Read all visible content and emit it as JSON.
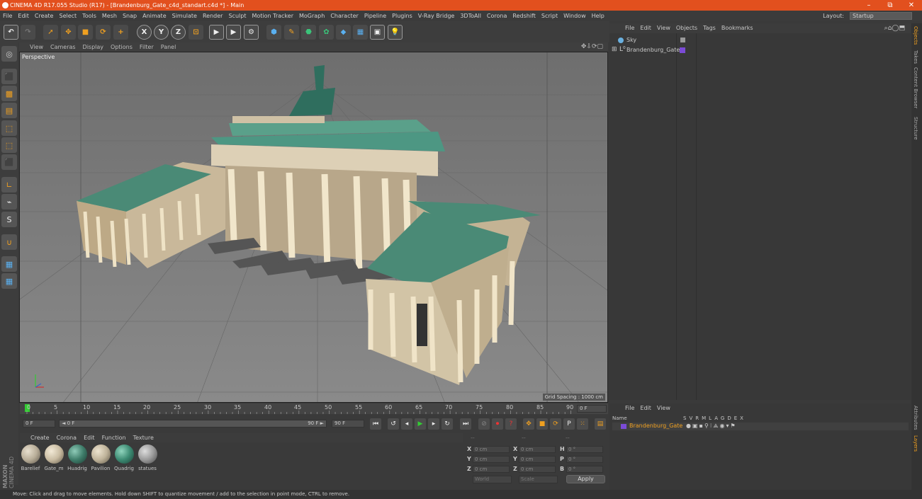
{
  "window": {
    "title": "CINEMA 4D R17.055 Studio (R17) - [Brandenburg_Gate_c4d_standart.c4d *] - Main",
    "minimize": "–",
    "restore": "⧉",
    "close": "✕"
  },
  "menubar": {
    "items": [
      "File",
      "Edit",
      "Create",
      "Select",
      "Tools",
      "Mesh",
      "Snap",
      "Animate",
      "Simulate",
      "Render",
      "Sculpt",
      "Motion Tracker",
      "MoGraph",
      "Character",
      "Pipeline",
      "Plugins",
      "V-Ray Bridge",
      "3DToAll",
      "Corona",
      "Redshift",
      "Script",
      "Window",
      "Help"
    ],
    "layout_label": "Layout:",
    "layout_value": "Startup"
  },
  "toolbar": {
    "x": "X",
    "y": "Y",
    "z": "Z"
  },
  "viewport": {
    "menu": [
      "View",
      "Cameras",
      "Display",
      "Options",
      "Filter",
      "Panel"
    ],
    "label": "Perspective",
    "grid_spacing": "Grid Spacing : 1000 cm"
  },
  "timeline": {
    "ticks": [
      "0",
      "5",
      "10",
      "15",
      "20",
      "25",
      "30",
      "35",
      "40",
      "45",
      "50",
      "55",
      "60",
      "65",
      "70",
      "75",
      "80",
      "85",
      "90"
    ],
    "end_field": "0 F"
  },
  "playbar": {
    "start": "0 F",
    "current": "◄ 0 F",
    "end_slider": "90 F ►",
    "end": "90 F"
  },
  "materials": {
    "menu": [
      "Create",
      "Corona",
      "Edit",
      "Function",
      "Texture"
    ],
    "items": [
      {
        "name": "Barelief",
        "color": "#b8ad98"
      },
      {
        "name": "Gate_m",
        "color": "#c9bca2"
      },
      {
        "name": "Huadrig",
        "color": "#3f7d6a"
      },
      {
        "name": "Pavilion",
        "color": "#bfb39a"
      },
      {
        "name": "Quadrig",
        "color": "#3c8a72"
      },
      {
        "name": "statues",
        "color": "#9a9a9a"
      }
    ]
  },
  "coords": {
    "rows": [
      {
        "axis": "X",
        "pos": "0 cm",
        "axis2": "X",
        "size": "0 cm",
        "rot_axis": "H",
        "rot": "0 °"
      },
      {
        "axis": "Y",
        "pos": "0 cm",
        "axis2": "Y",
        "size": "0 cm",
        "rot_axis": "P",
        "rot": "0 °"
      },
      {
        "axis": "Z",
        "pos": "0 cm",
        "axis2": "Z",
        "size": "0 cm",
        "rot_axis": "B",
        "rot": "0 °"
      }
    ],
    "world": "World",
    "scale": "Scale",
    "apply": "Apply",
    "header_dashes": [
      "--",
      "--",
      "--"
    ]
  },
  "objects": {
    "menu": [
      "File",
      "Edit",
      "View",
      "Objects",
      "Tags",
      "Bookmarks"
    ],
    "items": [
      {
        "name": "Sky"
      },
      {
        "name": "Brandenburg_Gate"
      }
    ]
  },
  "layers": {
    "menu": [
      "File",
      "Edit",
      "View"
    ],
    "header_name": "Name",
    "header_cols": [
      "S",
      "V",
      "R",
      "M",
      "L",
      "A",
      "G",
      "D",
      "E",
      "X"
    ],
    "row": "Brandenburg_Gate"
  },
  "right_tabs": [
    "Objects",
    "Takes",
    "Content Browser",
    "Structure",
    "Attributes",
    "Layers"
  ],
  "status": "Move: Click and drag to move elements. Hold down SHIFT to quantize movement / add to the selection in point mode, CTRL to remove.",
  "brand": {
    "maxon": "MAXON",
    "c4d": "CINEMA 4D"
  }
}
